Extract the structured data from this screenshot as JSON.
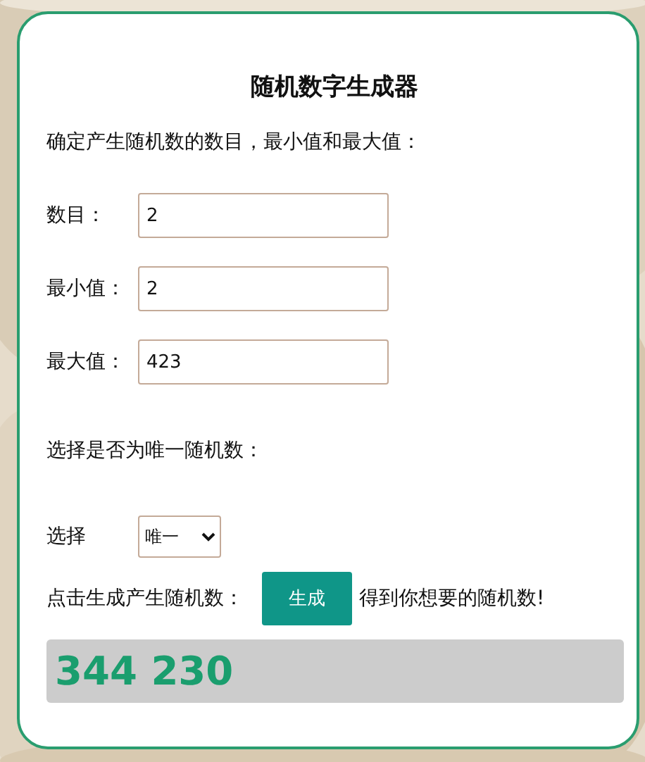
{
  "title": "随机数字生成器",
  "intro": "确定产生随机数的数目，最小值和最大值：",
  "fields": [
    {
      "label": "数目：",
      "value": "2"
    },
    {
      "label": "最小值：",
      "value": "2"
    },
    {
      "label": "最大值：",
      "value": "423"
    }
  ],
  "unique_prompt": "选择是否为唯一随机数：",
  "choice": {
    "label": "选择",
    "value": "唯一"
  },
  "generate": {
    "prompt": "点击生成产生随机数：",
    "button": "生成",
    "after": "得到你想要的随机数!"
  },
  "result": "344 230"
}
